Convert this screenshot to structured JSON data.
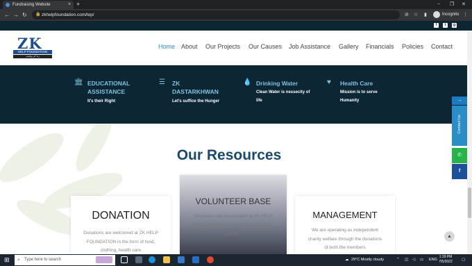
{
  "browser": {
    "tab_title": "Fundraising Website",
    "tab_close": "×",
    "new_tab": "+",
    "url": "zkhelpfoundation.com/lep/",
    "incognito_label": "Incognito",
    "win_min": "−",
    "win_max": "❐",
    "win_close": "✕",
    "back": "←",
    "forward": "→",
    "reload": "↻"
  },
  "social": {
    "facebook": "f",
    "twitter": "t",
    "instagram": "◎"
  },
  "logo": {
    "text": "ZK",
    "subtitle": "HELP FOUNDATION",
    "script": "زیڈ کے ویلفیئر"
  },
  "nav": {
    "items": [
      "Home",
      "About",
      "Our Projects",
      "Our Causes",
      "Job Assistance",
      "Gallery",
      "Financials",
      "Policies",
      "Contact"
    ]
  },
  "features": [
    {
      "icon": "bank-icon",
      "glyph": "🏛",
      "title": "EDUCATIONAL ASSISTANCE",
      "desc": "It's their Right"
    },
    {
      "icon": "database-icon",
      "glyph": "☰",
      "title": "ZK DASTARKHWAN",
      "desc": "Let's suffice the Hunger"
    },
    {
      "icon": "drop-icon",
      "glyph": "💧",
      "title": "Drinking Water",
      "desc": "Clean Water is nessecity of life"
    },
    {
      "icon": "heart-icon",
      "glyph": "♥",
      "title": "Health Care",
      "desc": "Mission is to serve Humanity"
    }
  ],
  "resources": {
    "title": "Our Resources",
    "cards": [
      {
        "title": "DONATION",
        "text": "Donations are welcomed at ZK HELP FOUNDATION in the form of food, clothing, health care"
      },
      {
        "title": "VOLUNTEER BASE",
        "text": "Volunteers are encouraged at ZK HELP FOUNDATION. As \"Every Good Deed is Charity\"."
      },
      {
        "title": "MANAGEMENT",
        "text": "We are operating as independent charity welfare through the donations of both the members"
      }
    ]
  },
  "side_widgets": {
    "arrow": "→",
    "contact": "Contact Us",
    "whatsapp": "✆",
    "facebook": "f"
  },
  "scroll_top": "▲",
  "taskbar": {
    "search_placeholder": "Type here to search",
    "weather": "29°C  Mostly cloudy",
    "lang": "ENG",
    "time": "1:19 PM",
    "date": "7/5/2022"
  }
}
